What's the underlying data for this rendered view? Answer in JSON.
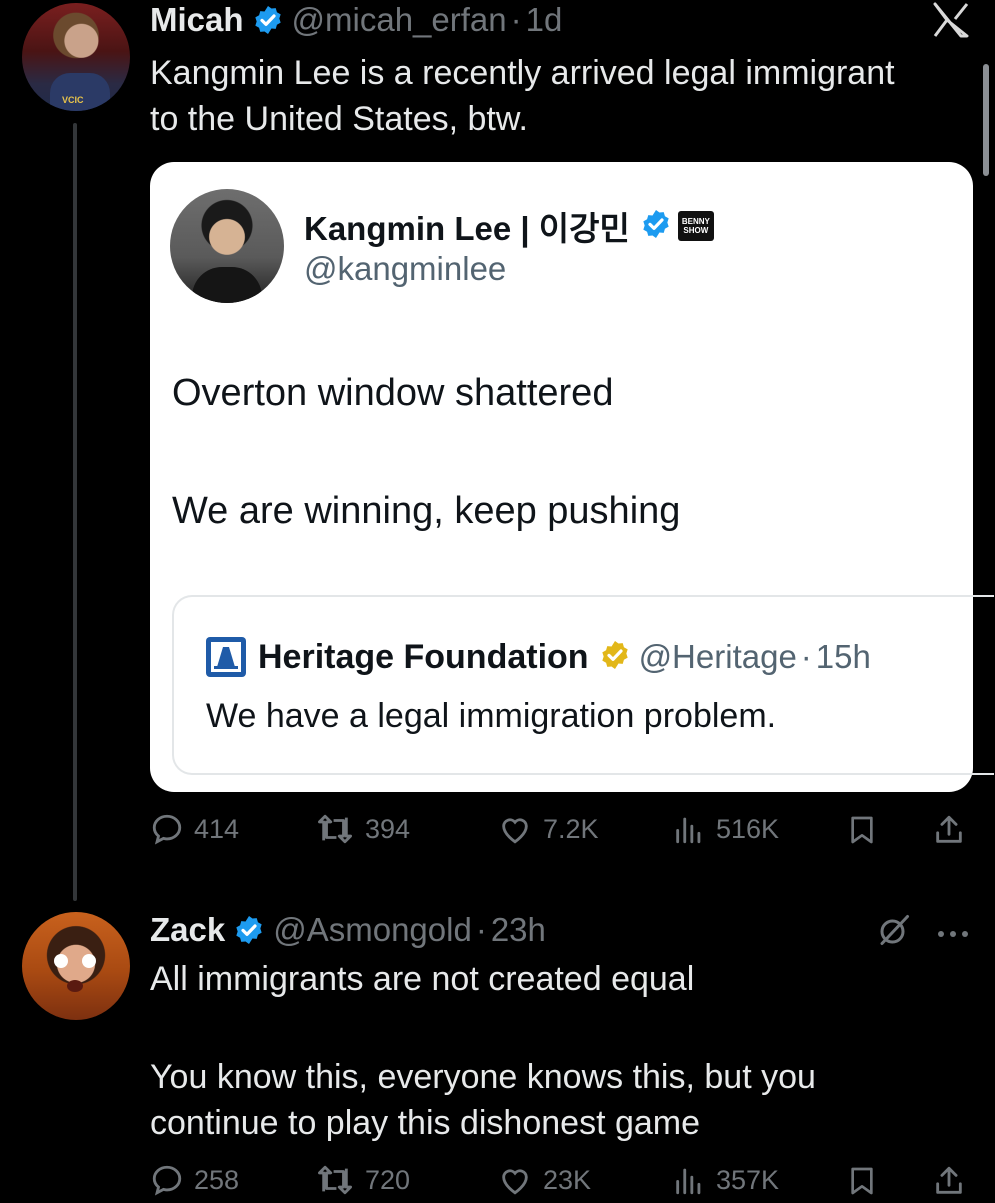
{
  "tweet1": {
    "name": "Micah",
    "handle": "@micah_erfan",
    "time_sep": "·",
    "time": "1d",
    "text_line1": "Kangmin Lee is a recently arrived legal immigrant",
    "text_line2": "to the United States, btw.",
    "avatar_shirt_text": "VCIC",
    "quote": {
      "name": "Kangmin Lee | 이강민",
      "handle": "@kangminlee",
      "badge_text_1": "BENNY",
      "badge_text_2": "SHOW",
      "line1": "Overton window shattered",
      "line2": "We are winning, keep pushing",
      "nested": {
        "name": "Heritage Foundation",
        "handle": "@Heritage",
        "time_sep": "·",
        "time": "15h",
        "text": "We have a legal immigration problem."
      }
    },
    "stats": {
      "replies": "414",
      "reposts": "394",
      "likes": "7.2K",
      "views": "516K"
    }
  },
  "tweet2": {
    "name": "Zack",
    "handle": "@Asmongold",
    "time_sep": "·",
    "time": "23h",
    "text_line1": "All immigrants are not created equal",
    "text_line2": "You know this, everyone knows this, but you",
    "text_line3": "continue to play this dishonest game",
    "stats": {
      "replies": "258",
      "reposts": "720",
      "likes": "23K",
      "views": "357K"
    }
  },
  "colors": {
    "verified_blue": "#1d9bf0",
    "verified_gold": "#e2b719",
    "background": "#000000",
    "muted": "#71767b"
  },
  "icons": [
    "x-logo-icon",
    "verified-badge-icon",
    "reply-icon",
    "repost-icon",
    "like-icon",
    "views-icon",
    "bookmark-icon",
    "share-icon",
    "grok-icon",
    "more-icon"
  ]
}
